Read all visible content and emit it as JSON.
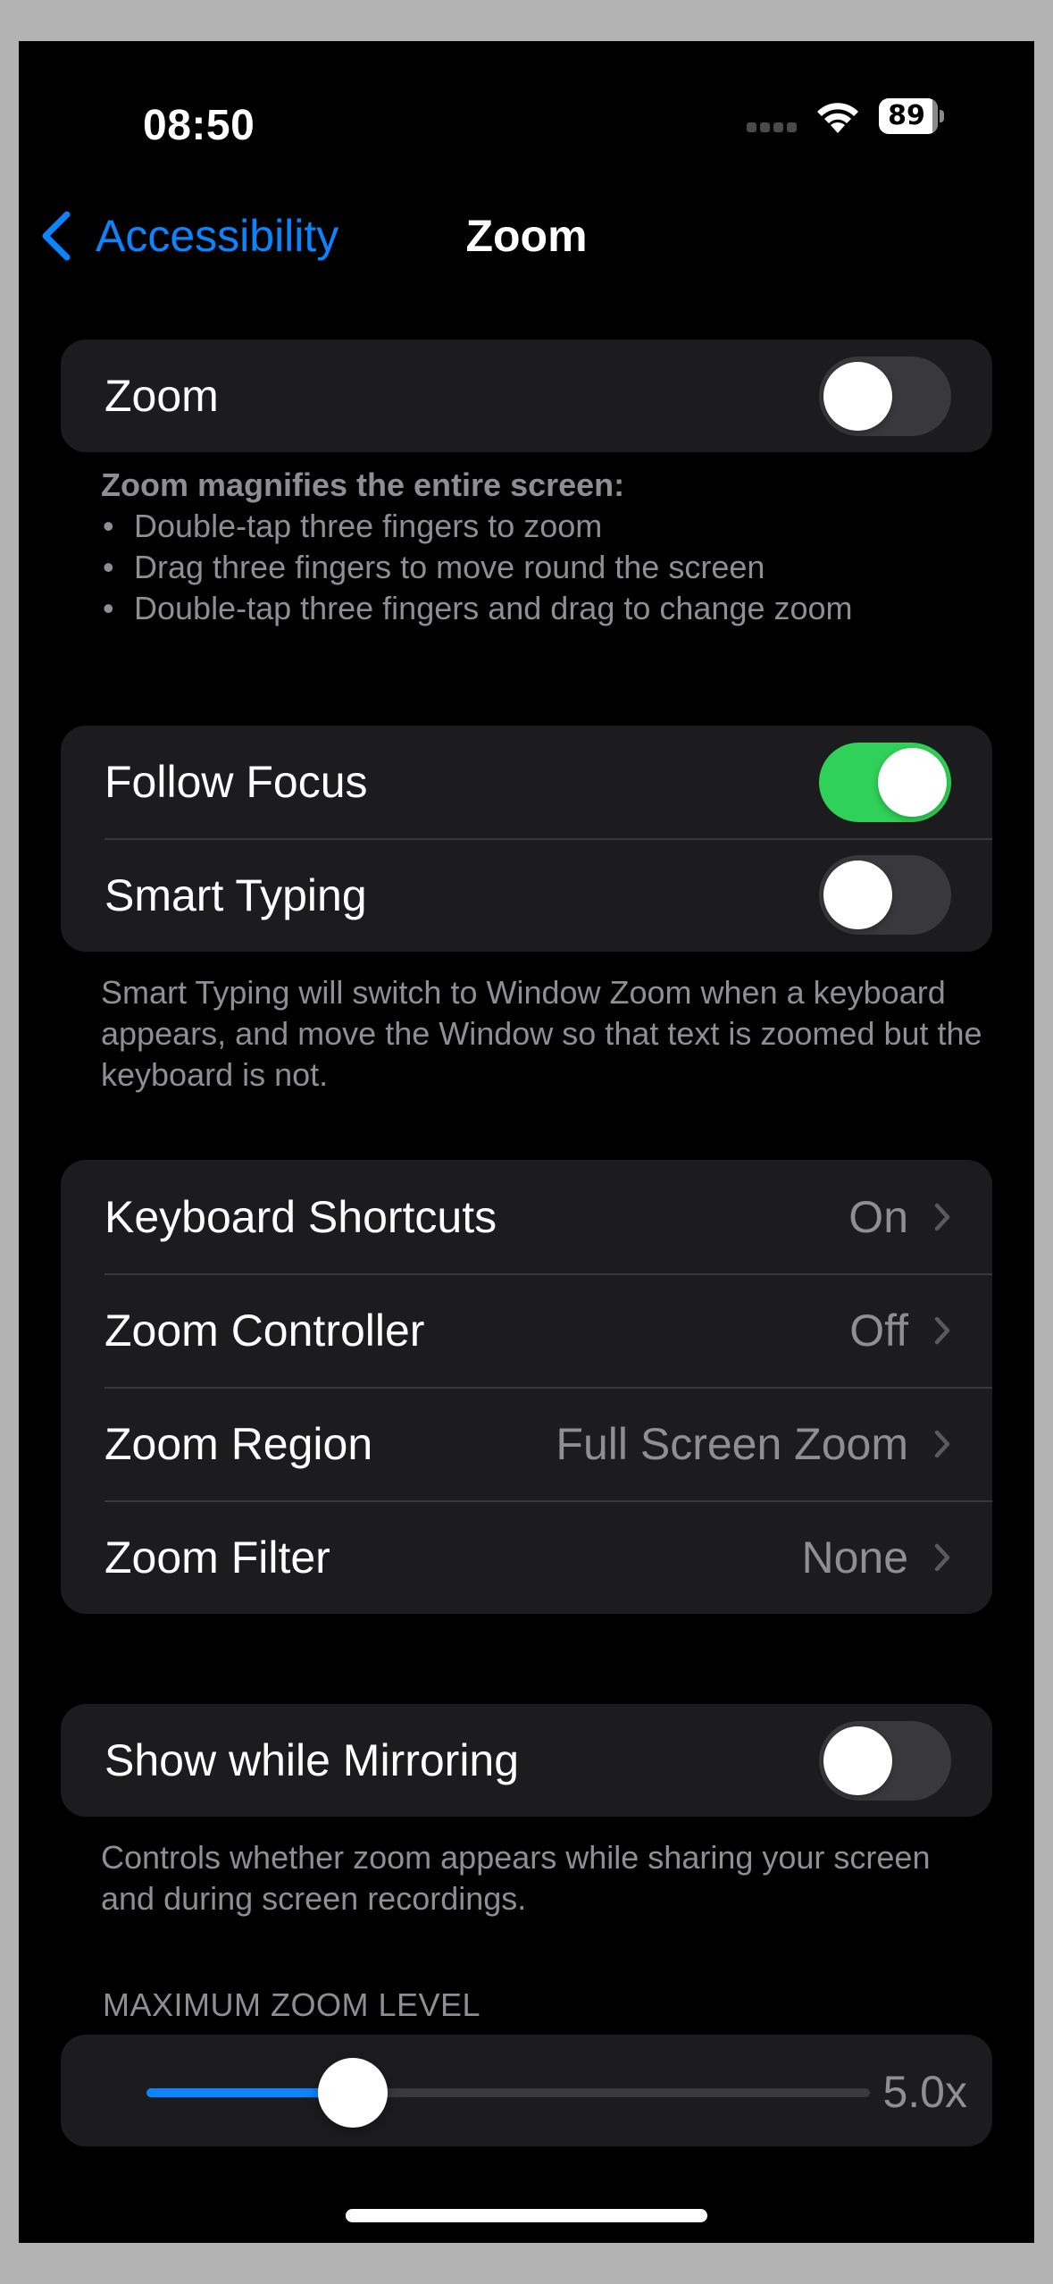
{
  "status_bar": {
    "time": "08:50",
    "battery_level": "89",
    "icons": [
      "cellular-signal-icon",
      "wifi-icon",
      "battery-icon"
    ]
  },
  "nav": {
    "back_label": "Accessibility",
    "back_icon": "chevron-left-icon",
    "title": "Zoom"
  },
  "zoom_section": {
    "toggle_label": "Zoom",
    "toggle_on": false,
    "footer_head": "Zoom magnifies the entire screen:",
    "footer_bullets": [
      "Double-tap three fingers to zoom",
      "Drag three fingers to move round the screen",
      "Double-tap three fingers and drag to change zoom"
    ],
    "bullet_char": "•"
  },
  "focus_section": {
    "rows": [
      {
        "label": "Follow Focus",
        "on": true
      },
      {
        "label": "Smart Typing",
        "on": false
      }
    ],
    "footer": "Smart Typing will switch to Window Zoom when a keyboard appears, and move the Window so that text is zoomed but the keyboard is not."
  },
  "options_section": {
    "rows": [
      {
        "label": "Keyboard Shortcuts",
        "value": "On"
      },
      {
        "label": "Zoom Controller",
        "value": "Off"
      },
      {
        "label": "Zoom Region",
        "value": "Full Screen Zoom"
      },
      {
        "label": "Zoom Filter",
        "value": "None"
      }
    ]
  },
  "mirroring_section": {
    "toggle_label": "Show while Mirroring",
    "toggle_on": false,
    "footer": "Controls whether zoom appears while sharing your screen and during screen recordings."
  },
  "max_zoom_section": {
    "header": "MAXIMUM ZOOM LEVEL",
    "value_label": "5.0x",
    "value": 5.0,
    "min": 1.0,
    "max": 15.0
  },
  "colors": {
    "accent": "#0a84ff",
    "toggle_on": "#30d158",
    "toggle_off": "#39393d",
    "card_bg": "#1c1c1e",
    "secondary_text": "#8e8e93"
  }
}
